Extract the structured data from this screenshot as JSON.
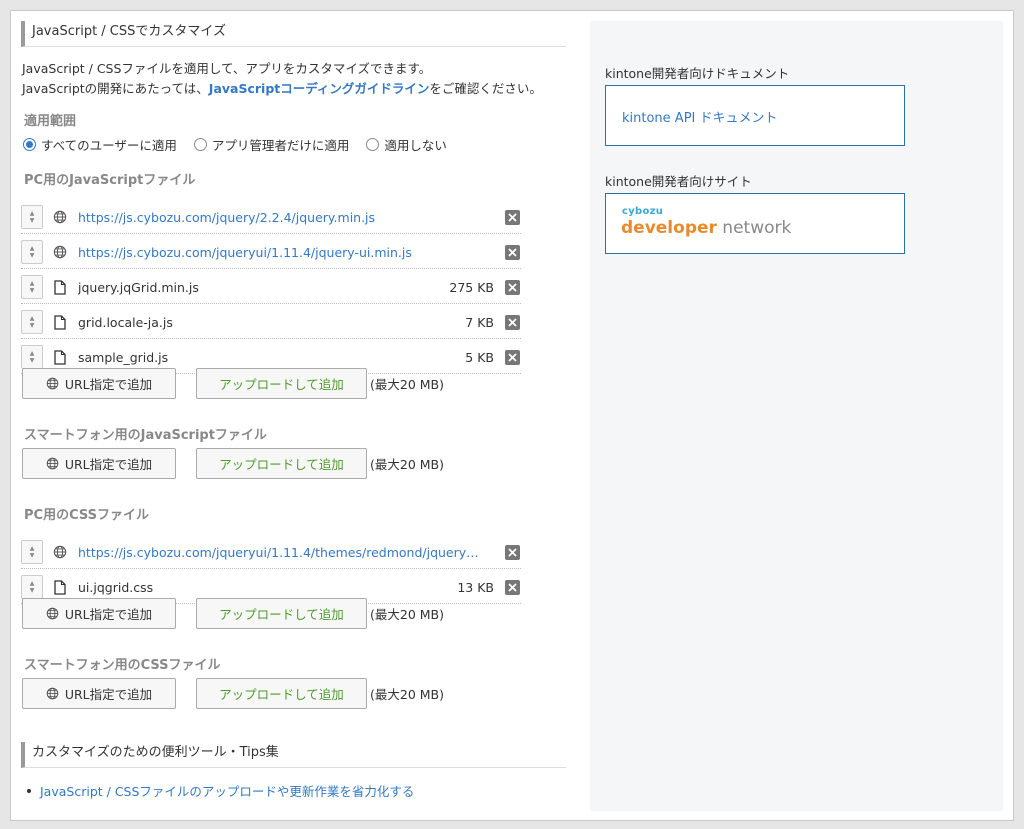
{
  "main": {
    "section_title": "JavaScript / CSSでカスタマイズ",
    "desc_line1": "JavaScript / CSSファイルを適用して、アプリをカスタマイズできます。",
    "desc_line2_pre": "JavaScriptの開発にあたっては、",
    "desc_line2_link": "JavaScriptコーディングガイドライン",
    "desc_line2_post": "をご確認ください。",
    "scope_heading": "適用範囲",
    "scope_options": [
      {
        "label": "すべてのユーザーに適用",
        "selected": true
      },
      {
        "label": "アプリ管理者だけに適用",
        "selected": false
      },
      {
        "label": "適用しない",
        "selected": false
      }
    ],
    "pc_js_heading": "PC用のJavaScriptファイル",
    "pc_js_files": [
      {
        "type": "url",
        "name": "https://js.cybozu.com/jquery/2.2.4/jquery.min.js",
        "size": ""
      },
      {
        "type": "url",
        "name": "https://js.cybozu.com/jqueryui/1.11.4/jquery-ui.min.js",
        "size": ""
      },
      {
        "type": "file",
        "name": "jquery.jqGrid.min.js",
        "size": "275 KB"
      },
      {
        "type": "file",
        "name": "grid.locale-ja.js",
        "size": "7 KB"
      },
      {
        "type": "file",
        "name": "sample_grid.js",
        "size": "5 KB"
      }
    ],
    "sp_js_heading": "スマートフォン用のJavaScriptファイル",
    "pc_css_heading": "PC用のCSSファイル",
    "pc_css_files": [
      {
        "type": "url",
        "name": "https://js.cybozu.com/jqueryui/1.11.4/themes/redmond/jquery…",
        "size": ""
      },
      {
        "type": "file",
        "name": "ui.jqgrid.css",
        "size": "13 KB"
      }
    ],
    "sp_css_heading": "スマートフォン用のCSSファイル",
    "url_button_label": "URL指定で追加",
    "upload_button_label": "アップロードして追加",
    "max_size": "(最大20 MB)",
    "tips_title": "カスタマイズのための便利ツール・Tips集",
    "tips_link": "JavaScript / CSSファイルのアップロードや更新作業を省力化する"
  },
  "side": {
    "doc_label": "kintone開発者向けドキュメント",
    "doc_link": "kintone API ドキュメント",
    "site_label": "kintone開発者向けサイト",
    "logo_small": "cybozu",
    "logo_dev": "developer",
    "logo_net": " network"
  },
  "colors": {
    "link": "#3478c6",
    "upload_text": "#4e9a2e",
    "logo_orange": "#e88b2e",
    "logo_blue": "#39a8d6"
  }
}
